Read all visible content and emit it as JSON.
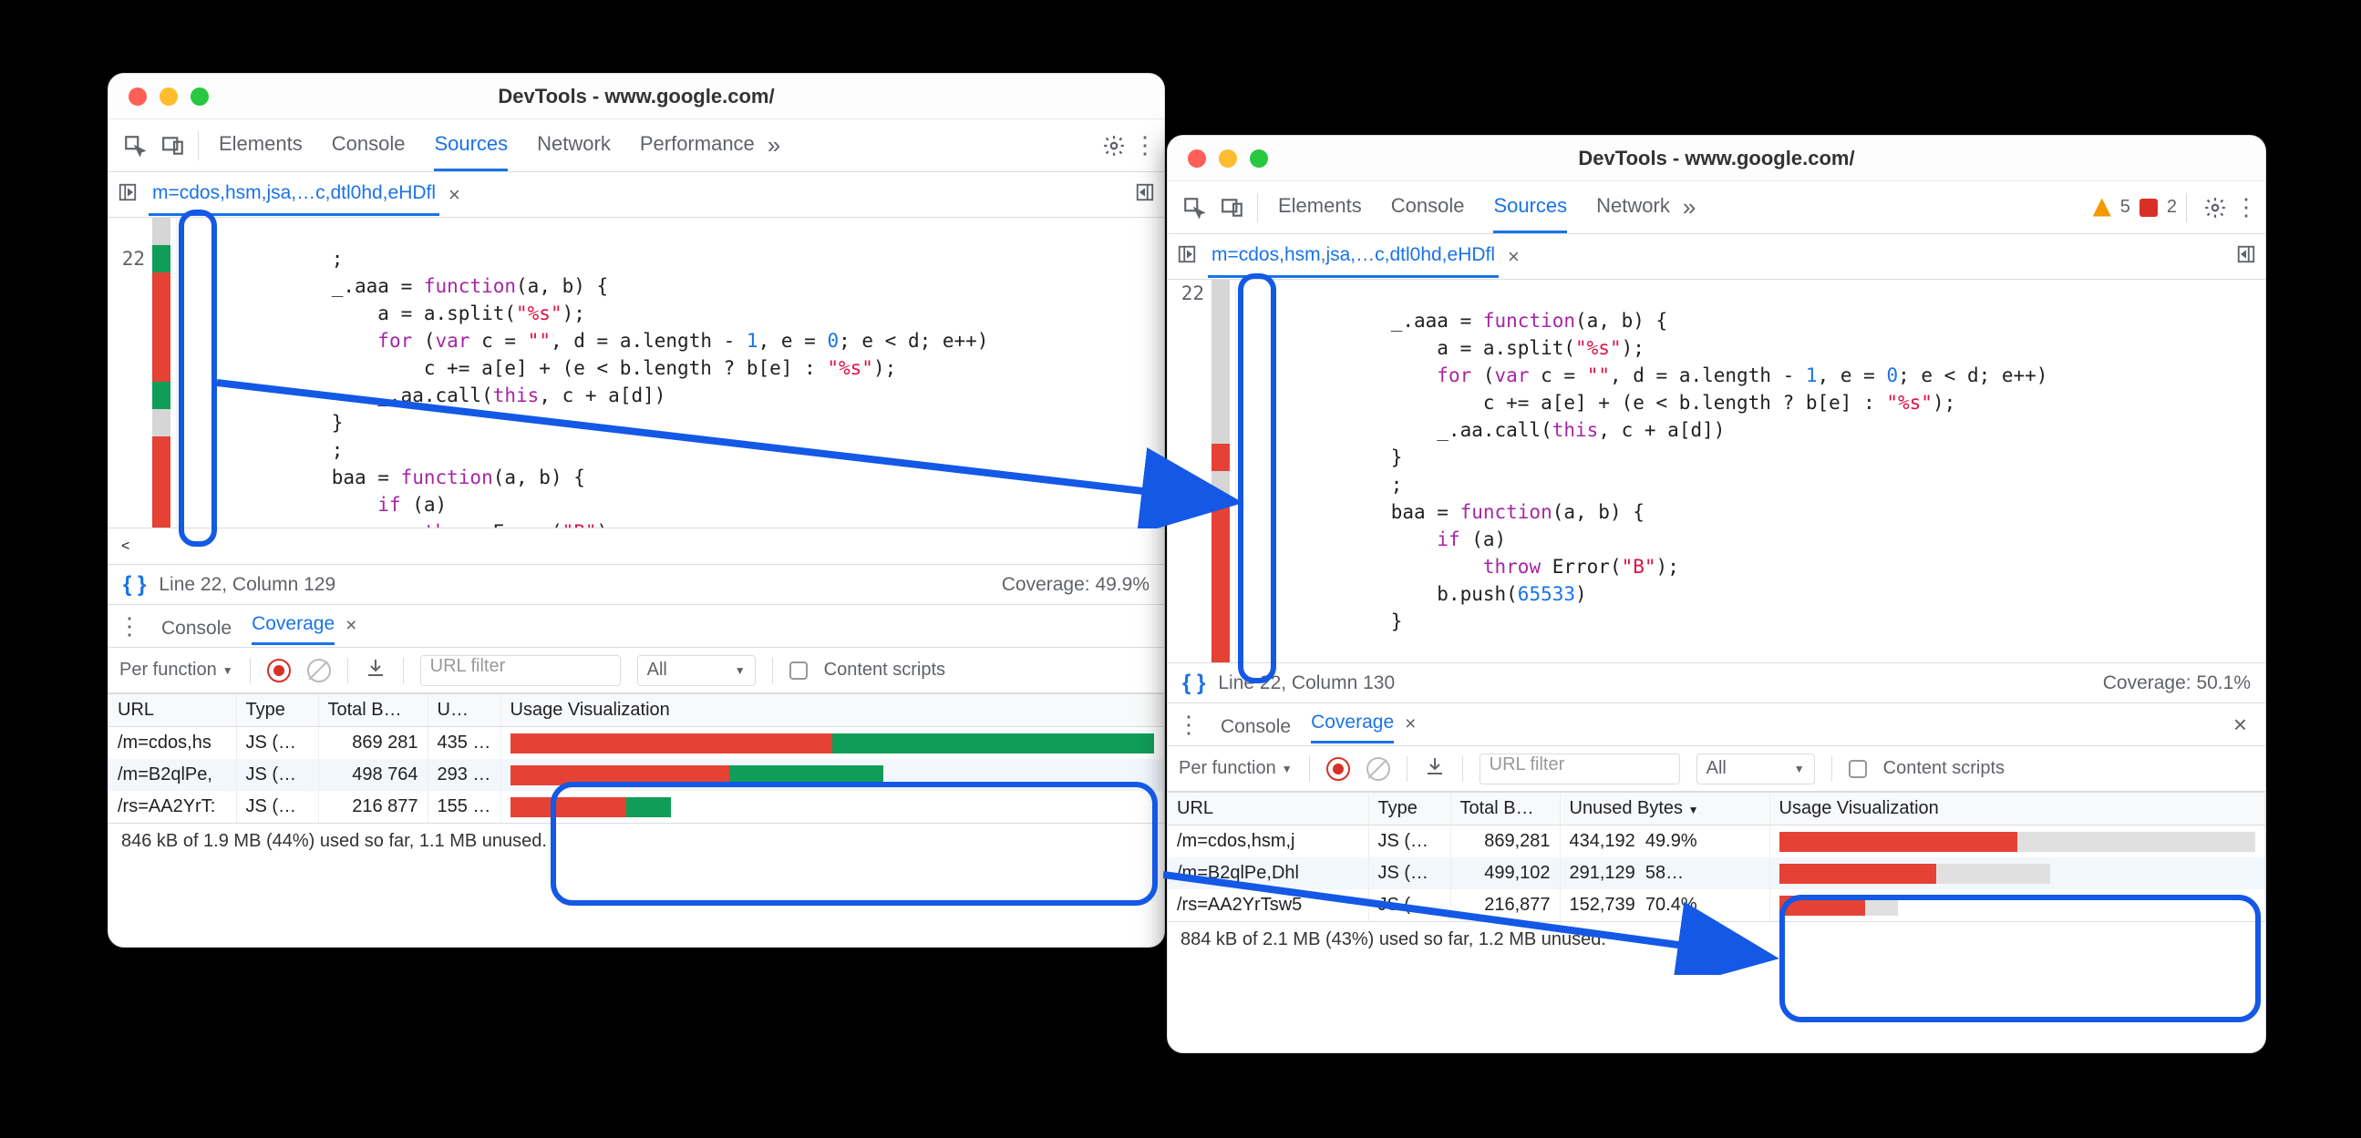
{
  "window1": {
    "title": "DevTools - www.google.com/",
    "tabs": [
      "Elements",
      "Console",
      "Sources",
      "Network",
      "Performance"
    ],
    "activeTab": "Sources",
    "openFile": "m=cdos,hsm,jsa,…c,dtl0hd,eHDfl",
    "lineNo": "22",
    "statusLine": "Line 22, Column 129",
    "statusCoverage": "Coverage: 49.9%",
    "drawerTabs": {
      "console": "Console",
      "coverage": "Coverage"
    },
    "perFunction": "Per function",
    "urlFilterPlaceholder": "URL filter",
    "typeAll": "All",
    "contentScripts": "Content scripts",
    "cols": {
      "url": "URL",
      "type": "Type",
      "total": "Total B…",
      "unused": "U…",
      "viz": "Usage Visualization"
    },
    "rows": [
      {
        "url": "/m=cdos,hs",
        "type": "JS (…",
        "total": "869 281",
        "unused": "435 …",
        "w": 100,
        "r": 50,
        "g": 50
      },
      {
        "url": "/m=B2qlPe,",
        "type": "JS (…",
        "total": "498 764",
        "unused": "293 …",
        "w": 58,
        "r": 34,
        "g": 24
      },
      {
        "url": "/rs=AA2YrT:",
        "type": "JS (…",
        "total": "216 877",
        "unused": "155 …",
        "w": 25,
        "r": 18,
        "g": 7
      }
    ],
    "footer": "846 kB of 1.9 MB (44%) used so far, 1.1 MB unused."
  },
  "window2": {
    "title": "DevTools - www.google.com/",
    "tabs": [
      "Elements",
      "Console",
      "Sources",
      "Network"
    ],
    "activeTab": "Sources",
    "warnCount": "5",
    "errCount": "2",
    "openFile": "m=cdos,hsm,jsa,…c,dtl0hd,eHDfl",
    "lineNo": "22",
    "statusLine": "Line 22, Column 130",
    "statusCoverage": "Coverage: 50.1%",
    "drawerTabs": {
      "console": "Console",
      "coverage": "Coverage"
    },
    "perFunction": "Per function",
    "urlFilterPlaceholder": "URL filter",
    "typeAll": "All",
    "contentScripts": "Content scripts",
    "cols": {
      "url": "URL",
      "type": "Type",
      "total": "Total B…",
      "unused": "Unused Bytes",
      "viz": "Usage Visualization"
    },
    "rows": [
      {
        "url": "/m=cdos,hsm,j",
        "type": "JS (…",
        "total": "869,281",
        "unused": "434,192",
        "pct": "49.9%",
        "w": 100,
        "r": 50
      },
      {
        "url": "/m=B2qlPe,Dhl",
        "type": "JS (…",
        "total": "499,102",
        "unused": "291,129",
        "pct": "58…",
        "w": 57,
        "r": 33
      },
      {
        "url": "/rs=AA2YrTsw5",
        "type": "JS (…",
        "total": "216,877",
        "unused": "152,739",
        "pct": "70.4%",
        "w": 25,
        "r": 18
      }
    ],
    "footer": "884 kB of 2.1 MB (43%) used so far, 1.2 MB unused."
  },
  "code": {
    "l1": "            ;",
    "l2_a": "            _.aaa = ",
    "l2_b": "function",
    "l2_c": "(a, b) {",
    "l3_a": "                a = a.split(",
    "l3_b": "\"%s\"",
    "l3_c": ");",
    "l4_a": "                ",
    "l4_b": "for",
    "l4_c": " (",
    "l4_d": "var",
    "l4_e": " c = ",
    "l4_f": "\"\"",
    "l4_g": ", d = a.length - ",
    "l4_h": "1",
    "l4_i": ", e = ",
    "l4_j": "0",
    "l4_k": "; e < d; e++)",
    "l5_a": "                    c += a[e] + (e < b.length ? b[e] : ",
    "l5_b": "\"%s\"",
    "l5_c": ");",
    "l6_a": "                _.aa.call(",
    "l6_b": "this",
    "l6_c": ", c + a[d])",
    "l7": "            }",
    "l8": "            ;",
    "l9_a": "            baa = ",
    "l9_b": "function",
    "l9_c": "(a, b) {",
    "l10_a": "                ",
    "l10_b": "if",
    "l10_c": " (a)",
    "l11_a": "                    ",
    "l11_b": "throw",
    "l11_c": " Error(",
    "l11_d": "\"B\"",
    "l11_e": ");",
    "l12_a": "                b.push(",
    "l12_b": "65533",
    "l12_c": ")",
    "l13": "            }"
  }
}
